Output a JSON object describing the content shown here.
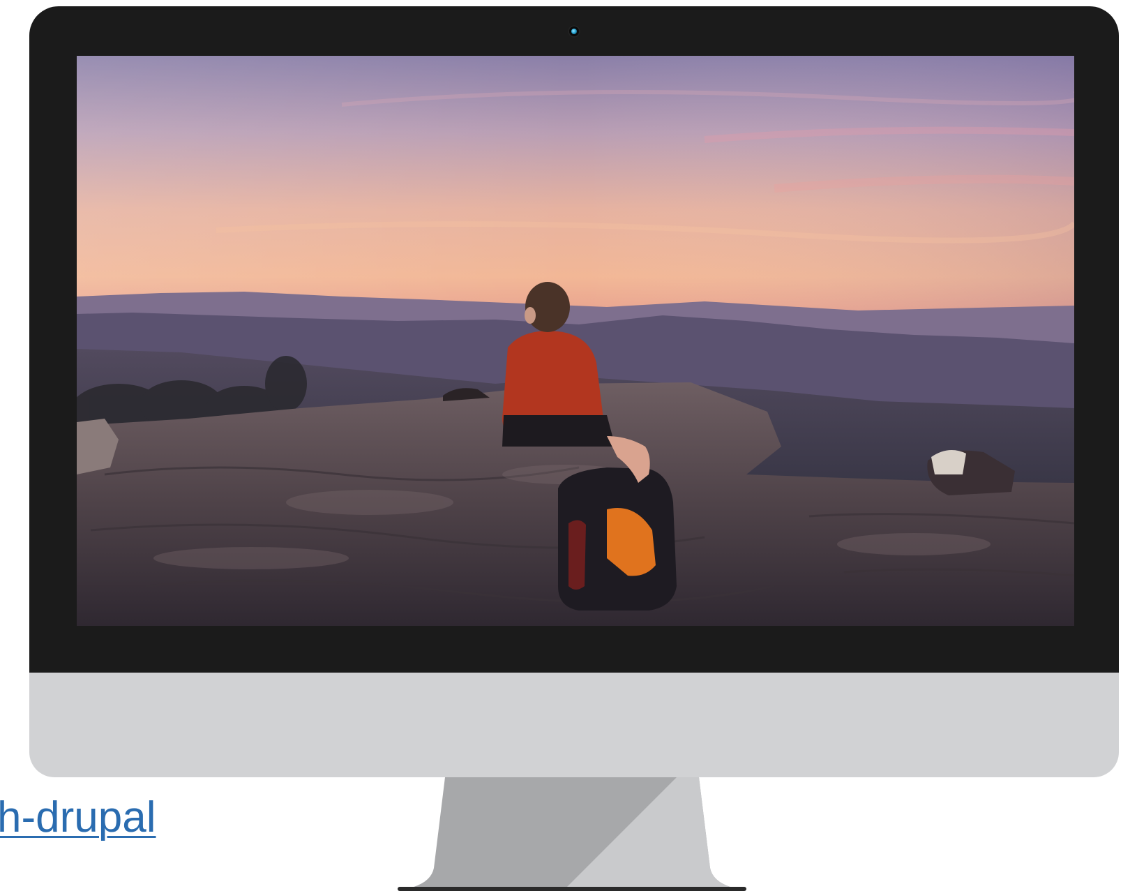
{
  "link": {
    "text": "h-drupal"
  },
  "colors": {
    "bezel": "#1b1b1b",
    "chin": "#d1d2d4",
    "stand_dark": "#a7a8aa",
    "stand_light": "#c9cacc",
    "link": "#2a6cb0"
  },
  "icons": {
    "camera": "webcam-icon"
  }
}
